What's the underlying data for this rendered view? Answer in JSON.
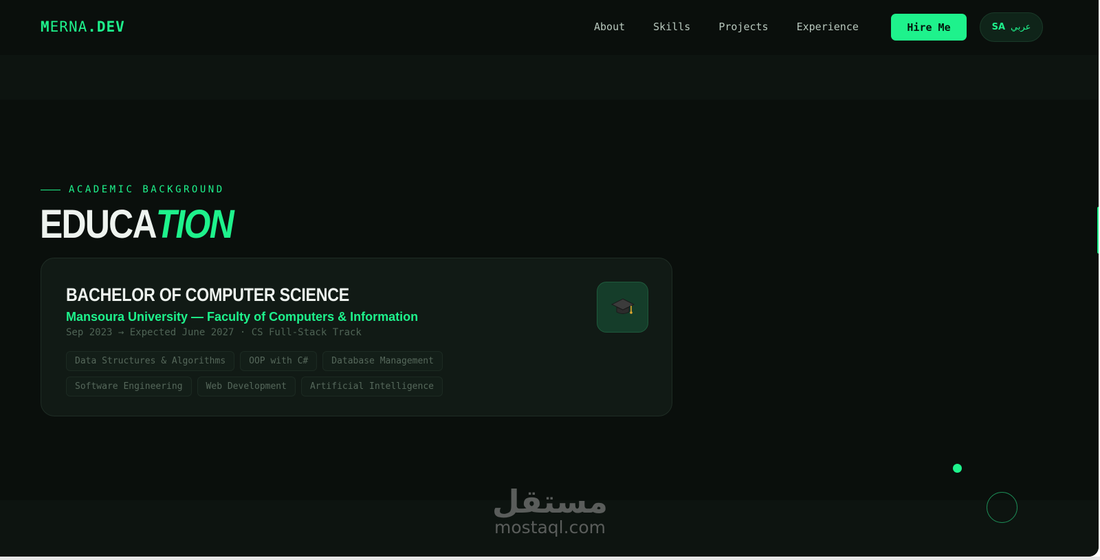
{
  "nav": {
    "logo": {
      "m": "M",
      "rest": "ERNA",
      "dot": ".",
      "dev": "DEV"
    },
    "links": [
      "About",
      "Skills",
      "Projects",
      "Experience"
    ],
    "hire_label": "Hire Me",
    "lang": {
      "code": "SA",
      "label": "عربي"
    }
  },
  "section": {
    "eyebrow": "ACADEMIC BACKGROUND",
    "title_a": "EDUCA",
    "title_b": "TION"
  },
  "education": {
    "degree": "BACHELOR OF COMPUTER SCIENCE",
    "university": "Mansoura University — Faculty of Computers & Information",
    "dates": "Sep 2023 → Expected June 2027 · CS Full-Stack Track",
    "icon": "graduation-cap-icon",
    "courses": [
      "Data Structures & Algorithms",
      "OOP with C#",
      "Database Management",
      "Software Engineering",
      "Web Development",
      "Artificial Intelligence"
    ]
  },
  "watermark": {
    "arabic": "مستقل",
    "latin": "mostaql.com"
  },
  "colors": {
    "accent": "#1ef28c",
    "background": "#0a0f0c",
    "card": "#111a15"
  }
}
